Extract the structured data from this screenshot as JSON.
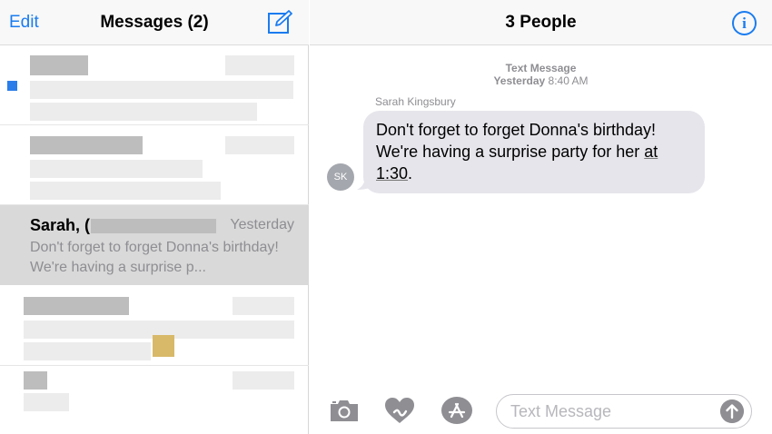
{
  "left_header": {
    "edit_label": "Edit",
    "title": "Messages (2)",
    "compose_icon": "compose-icon"
  },
  "conversations": {
    "selected": {
      "name": "Sarah, (",
      "time": "Yesterday",
      "preview": "Don't forget to forget Donna's birthday! We're having a surprise p..."
    }
  },
  "right_header": {
    "title": "3 People",
    "info_icon": "info-icon",
    "info_glyph": "i"
  },
  "thread": {
    "meta_label": "Text Message",
    "meta_day": "Yesterday",
    "meta_time": "8:40 AM",
    "sender_name": "Sarah Kingsbury",
    "avatar_initials": "SK",
    "message_part1": "Don't forget to forget Donna's birthday! We're having a surprise party for her ",
    "message_link": "at 1:30",
    "message_part2": "."
  },
  "input_bar": {
    "placeholder": "Text Message",
    "icons": [
      "camera-icon",
      "digital-touch-icon",
      "app-store-icon",
      "send-arrow-icon"
    ]
  },
  "colors": {
    "accent": "#1a7cf0",
    "bubble": "#e6e5eb",
    "selected_row": "#d9d9d9",
    "muted_text": "#8e8e93"
  }
}
